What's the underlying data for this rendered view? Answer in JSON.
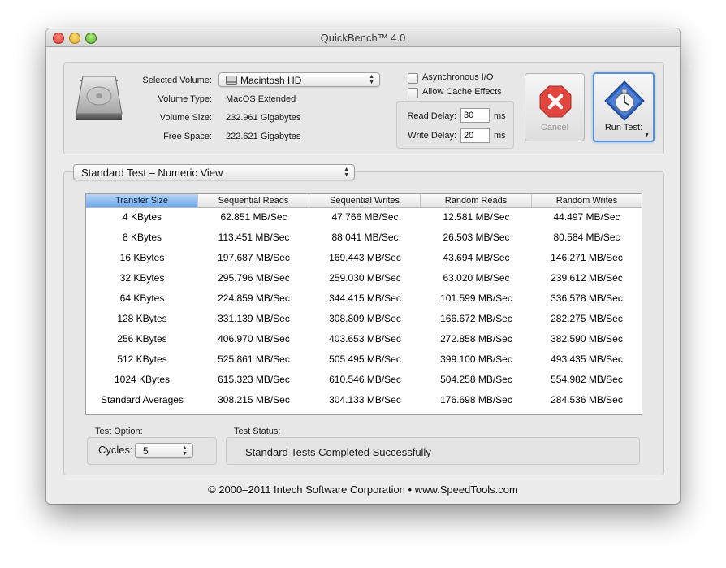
{
  "window": {
    "title": "QuickBench™ 4.0"
  },
  "volume": {
    "selected_label": "Selected Volume:",
    "selected_value": "Macintosh HD",
    "type_label": "Volume Type:",
    "type_value": "MacOS Extended",
    "size_label": "Volume Size:",
    "size_value": "232.961 Gigabytes",
    "free_label": "Free Space:",
    "free_value": "222.621 Gigabytes"
  },
  "options": {
    "async_label": "Asynchronous I/O",
    "cache_label": "Allow Cache Effects",
    "read_delay_label": "Read Delay:",
    "read_delay_value": "30",
    "write_delay_label": "Write Delay:",
    "write_delay_value": "20",
    "unit": "ms"
  },
  "buttons": {
    "cancel_label": "Cancel",
    "run_label": "Run Test:"
  },
  "test_view": {
    "selected": "Standard Test – Numeric View"
  },
  "table": {
    "columns": [
      "Transfer Size",
      "Sequential Reads",
      "Sequential Writes",
      "Random Reads",
      "Random Writes"
    ],
    "rows": [
      [
        "4 KBytes",
        "62.851 MB/Sec",
        "47.766 MB/Sec",
        "12.581 MB/Sec",
        "44.497 MB/Sec"
      ],
      [
        "8 KBytes",
        "113.451 MB/Sec",
        "88.041 MB/Sec",
        "26.503 MB/Sec",
        "80.584 MB/Sec"
      ],
      [
        "16 KBytes",
        "197.687 MB/Sec",
        "169.443 MB/Sec",
        "43.694 MB/Sec",
        "146.271 MB/Sec"
      ],
      [
        "32 KBytes",
        "295.796 MB/Sec",
        "259.030 MB/Sec",
        "63.020 MB/Sec",
        "239.612 MB/Sec"
      ],
      [
        "64 KBytes",
        "224.859 MB/Sec",
        "344.415 MB/Sec",
        "101.599 MB/Sec",
        "336.578 MB/Sec"
      ],
      [
        "128 KBytes",
        "331.139 MB/Sec",
        "308.809 MB/Sec",
        "166.672 MB/Sec",
        "282.275 MB/Sec"
      ],
      [
        "256 KBytes",
        "406.970 MB/Sec",
        "403.653 MB/Sec",
        "272.858 MB/Sec",
        "382.590 MB/Sec"
      ],
      [
        "512 KBytes",
        "525.861 MB/Sec",
        "505.495 MB/Sec",
        "399.100 MB/Sec",
        "493.435 MB/Sec"
      ],
      [
        "1024 KBytes",
        "615.323 MB/Sec",
        "610.546 MB/Sec",
        "504.258 MB/Sec",
        "554.982 MB/Sec"
      ],
      [
        "Standard Averages",
        "308.215 MB/Sec",
        "304.133 MB/Sec",
        "176.698 MB/Sec",
        "284.536 MB/Sec"
      ]
    ]
  },
  "test_option": {
    "label": "Test Option:",
    "cycles_label": "Cycles:",
    "cycles_value": "5"
  },
  "test_status": {
    "label": "Test Status:",
    "value": "Standard Tests Completed Successfully"
  },
  "footer": {
    "text": "© 2000–2011 Intech Software Corporation • www.SpeedTools.com"
  },
  "colors": {
    "selected_header": "#6da6ea",
    "run_focus": "#5a8fd8",
    "stop_red": "#e0352b"
  },
  "icons": [
    "hard-drive-icon",
    "stop-icon",
    "stopwatch-icon",
    "popup-arrows-icon"
  ]
}
